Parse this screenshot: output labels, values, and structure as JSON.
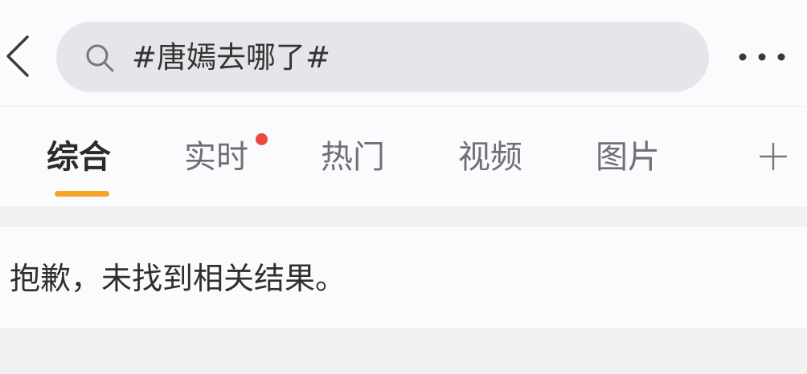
{
  "header": {
    "back_icon": "chevron-left-icon",
    "search": {
      "icon": "search-icon",
      "value": "#唐嫣去哪了#"
    },
    "more_icon": "more-horizontal-icon"
  },
  "tabs": {
    "items": [
      {
        "label": "综合",
        "active": true
      },
      {
        "label": "实时",
        "has_dot": true
      },
      {
        "label": "热门"
      },
      {
        "label": "视频"
      },
      {
        "label": "图片"
      }
    ],
    "add_icon": "plus-icon",
    "accent_color": "#f5a623",
    "dot_color": "#e94a3f"
  },
  "results": {
    "empty_message": "抱歉，未找到相关结果。"
  }
}
